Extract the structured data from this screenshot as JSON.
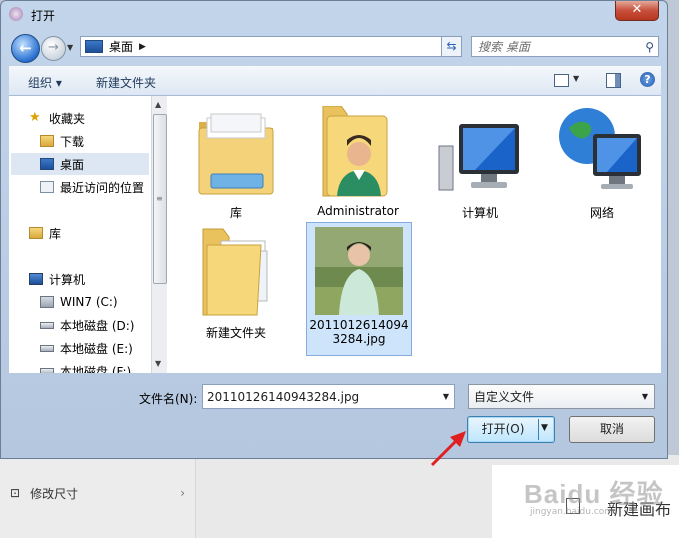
{
  "dialog": {
    "title": "打开",
    "close_glyph": "✕"
  },
  "nav": {
    "address_crumb": "桌面",
    "search_placeholder": "搜索 桌面"
  },
  "toolbar": {
    "organize": "组织 ▾",
    "new_folder": "新建文件夹",
    "help": "?"
  },
  "sidebar": {
    "items": [
      {
        "label": "收藏夹",
        "icon": "star-icon"
      },
      {
        "label": "下载",
        "icon": "download-folder-icon"
      },
      {
        "label": "桌面",
        "icon": "desktop-icon",
        "selected": true
      },
      {
        "label": "最近访问的位置",
        "icon": "recent-places-icon"
      },
      {
        "label": "库",
        "icon": "library-icon"
      },
      {
        "label": "计算机",
        "icon": "computer-icon"
      },
      {
        "label": "WIN7 (C:)",
        "icon": "system-drive-icon"
      },
      {
        "label": "本地磁盘 (D:)",
        "icon": "drive-icon"
      },
      {
        "label": "本地磁盘 (E:)",
        "icon": "drive-icon"
      },
      {
        "label": "本地磁盘 (F:)",
        "icon": "drive-icon"
      }
    ]
  },
  "files": [
    {
      "label": "库",
      "icon": "library-folder-icon"
    },
    {
      "label": "Administrator",
      "icon": "user-folder-icon"
    },
    {
      "label": "计算机",
      "icon": "computer-icon"
    },
    {
      "label": "网络",
      "icon": "network-icon"
    },
    {
      "label": "新建文件夹",
      "icon": "folder-icon"
    },
    {
      "label_line1": "2011012614094",
      "label_line2": "3284.jpg",
      "icon": "photo-thumbnail",
      "selected": true
    }
  ],
  "bottom": {
    "filename_label": "文件名(N):",
    "filename_value": "20110126140943284.jpg",
    "filter_value": "自定义文件",
    "open_label": "打开(O)",
    "cancel_label": "取消"
  },
  "background": {
    "menu_item": "修改尺寸",
    "right_label": "新建画布",
    "watermark": "Baidu 经验",
    "watermark_sub": "jingyan.baidu.com"
  },
  "colors": {
    "dialog_frame": "#c3d5ea",
    "selection": "#cde4fb",
    "close_button": "#c7503c",
    "annotation_arrow": "#e02020"
  }
}
